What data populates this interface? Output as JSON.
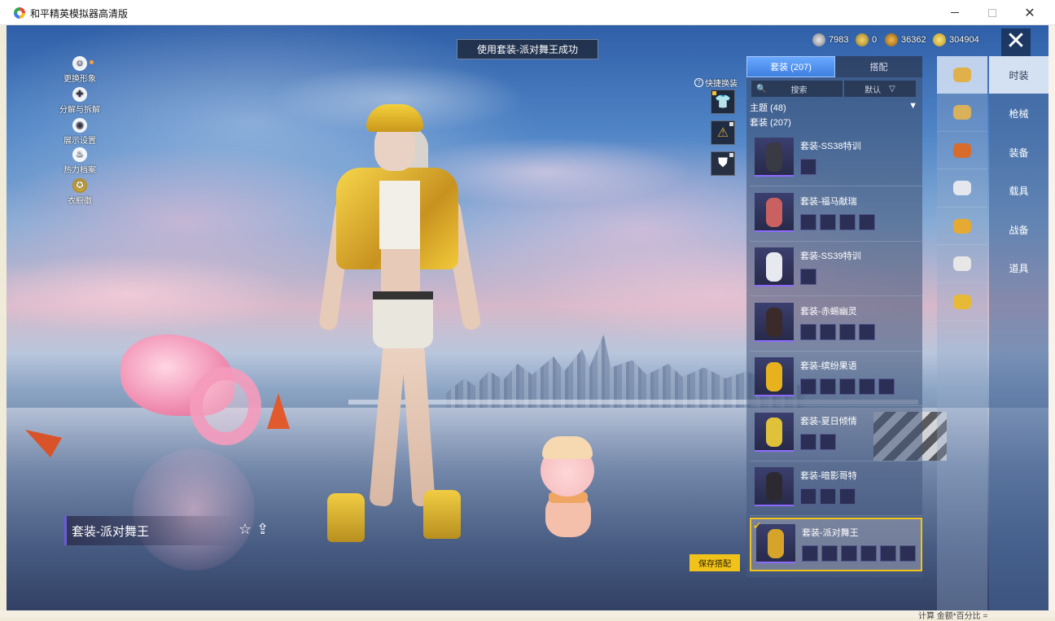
{
  "window": {
    "title": "和平精英模拟器高清版",
    "minimize": "",
    "maximize": "",
    "close": "✕"
  },
  "toast": "使用套装-派对舞王成功",
  "currencies": [
    {
      "value": "7983",
      "icon": "silver-coin-icon"
    },
    {
      "value": "0",
      "icon": "gold-token-icon"
    },
    {
      "value": "36362",
      "icon": "bronze-coin-icon"
    },
    {
      "value": "304904",
      "icon": "gold-coin-icon"
    }
  ],
  "close_game": "✕",
  "left_menu": [
    {
      "label": "更换形象",
      "icon": "person-icon",
      "glyph": "☺"
    },
    {
      "label": "分解与拆解",
      "icon": "puzzle-icon",
      "glyph": "✚"
    },
    {
      "label": "展示设置",
      "icon": "eye-icon",
      "glyph": "◉"
    },
    {
      "label": "热力档案",
      "icon": "flame-icon",
      "glyph": "♨"
    },
    {
      "label": "衣橱徽",
      "icon": "badge-icon",
      "glyph": "✪"
    }
  ],
  "quick_change": {
    "label": "快捷换装",
    "help": "?",
    "buttons": [
      {
        "glyph": "👕",
        "icon": "shirt-icon"
      },
      {
        "glyph": "⚠",
        "icon": "badge-icon"
      },
      {
        "glyph": "⛊",
        "icon": "shield-icon"
      }
    ]
  },
  "current_outfit": {
    "name": "套装-派对舞王",
    "star": "☆",
    "share": "⇪"
  },
  "save_button": "保存搭配",
  "panel": {
    "tabs": [
      {
        "label": "套装 (207)",
        "active": true
      },
      {
        "label": "搭配",
        "active": false
      }
    ],
    "search_placeholder": "搜索",
    "search_icon": "🔍",
    "sort": {
      "label": "默认",
      "arrow": "▽"
    },
    "filter_theme": "主题 (48)",
    "filter_arrow": "▼",
    "filter_set": "套装 (207)",
    "items": [
      {
        "name": "套装-SS38特训",
        "parts": 1,
        "color": "#3a3a44",
        "selected": false
      },
      {
        "name": "套装-福马献瑞",
        "parts": 4,
        "color": "#c8615f",
        "selected": false
      },
      {
        "name": "套装-SS39特训",
        "parts": 1,
        "color": "#e8e8ef",
        "selected": false
      },
      {
        "name": "套装-赤蜴幽灵",
        "parts": 4,
        "color": "#3b2a2a",
        "selected": false
      },
      {
        "name": "套装-缤纷果语",
        "parts": 5,
        "color": "#e8b21f",
        "selected": false
      },
      {
        "name": "套装-夏日倾情",
        "parts": 2,
        "color": "#e0c23a",
        "selected": false
      },
      {
        "name": "套装-暗影哥特",
        "parts": 3,
        "color": "#2c2a30",
        "selected": false
      },
      {
        "name": "套装-派对舞王",
        "parts": 6,
        "color": "#d6a42b",
        "selected": true,
        "check": "✔"
      }
    ]
  },
  "rail_icons": [
    {
      "icon": "outfit-icon",
      "color": "#e0b04a",
      "active": true
    },
    {
      "icon": "helmet-icon",
      "color": "#d9b15a",
      "active": false
    },
    {
      "icon": "weapon-skin-icon",
      "color": "#d86c2b",
      "active": false
    },
    {
      "icon": "mask-icon",
      "color": "#e4e7ee",
      "active": false
    },
    {
      "icon": "accessory-icon",
      "color": "#e4aa33",
      "active": false
    },
    {
      "icon": "vehicle-icon",
      "color": "#e7e7e7",
      "active": false
    },
    {
      "icon": "gloves-icon",
      "color": "#e7b936",
      "active": false
    }
  ],
  "category_tabs": [
    {
      "label": "时装",
      "active": true
    },
    {
      "label": "枪械",
      "active": false
    },
    {
      "label": "装备",
      "active": false
    },
    {
      "label": "载具",
      "active": false
    },
    {
      "label": "战备",
      "active": false
    },
    {
      "label": "道具",
      "active": false
    }
  ],
  "desktop_fragment": "计算 金额*百分比 ="
}
